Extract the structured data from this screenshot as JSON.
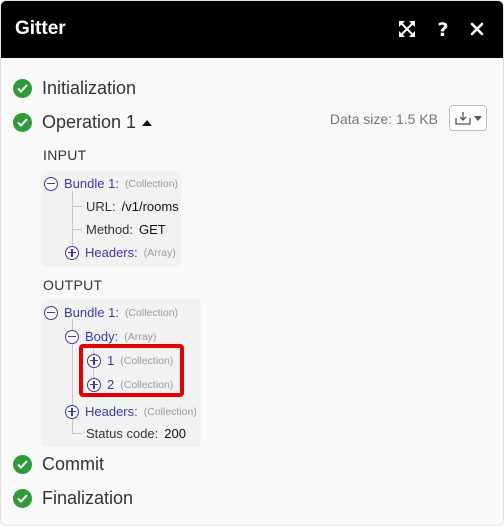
{
  "window": {
    "title": "Gitter"
  },
  "steps": {
    "initialization": "Initialization",
    "operation": "Operation 1",
    "commit": "Commit",
    "finalization": "Finalization"
  },
  "data_size": "Data size: 1.5 KB",
  "input": {
    "label": "INPUT",
    "bundle_key": "Bundle 1:",
    "bundle_type": "(Collection)",
    "url_key": "URL:",
    "url_val": "/v1/rooms",
    "method_key": "Method:",
    "method_val": "GET",
    "headers_key": "Headers:",
    "headers_type": "(Array)"
  },
  "output": {
    "label": "OUTPUT",
    "bundle_key": "Bundle 1:",
    "bundle_type": "(Collection)",
    "body_key": "Body:",
    "body_type": "(Array)",
    "item1_key": "1",
    "item1_type": "(Collection)",
    "item2_key": "2",
    "item2_type": "(Collection)",
    "headers_key": "Headers:",
    "headers_type": "(Collection)",
    "status_key": "Status code:",
    "status_val": "200"
  },
  "colors": {
    "accent": "#2e9a3a",
    "tree_link": "#3a3aa6",
    "highlight": "#e30000"
  },
  "icons": [
    "expand-icon",
    "help-icon",
    "close-icon",
    "check-icon",
    "download-icon"
  ]
}
